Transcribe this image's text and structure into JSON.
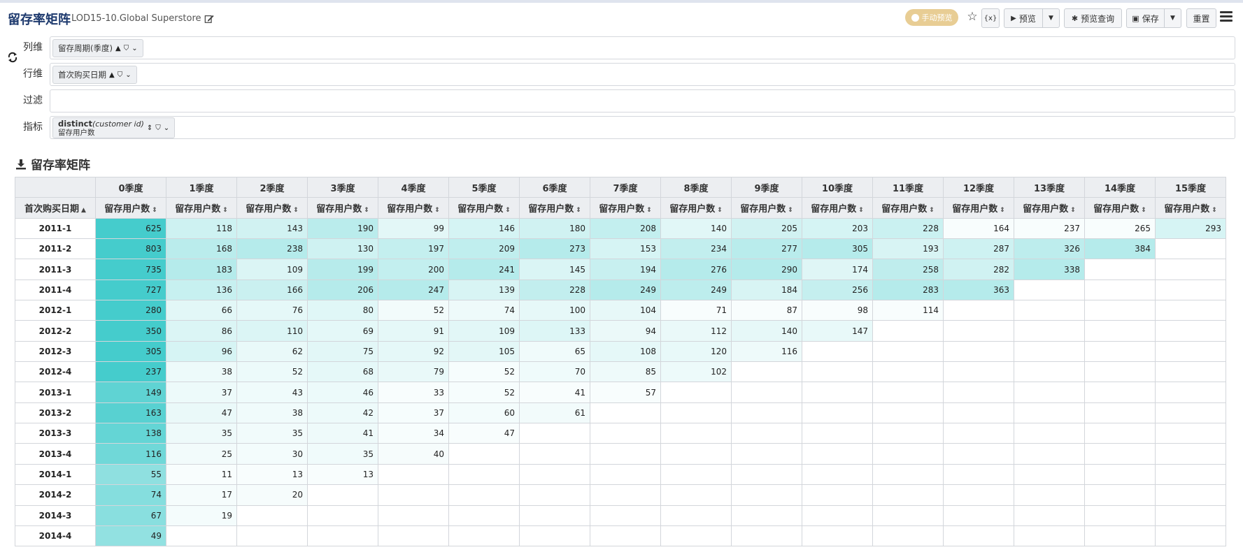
{
  "header": {
    "title": "留存率矩阵",
    "subtitle": "LOD15-10.Global Superstore",
    "manual_preview": "手动预览",
    "var_label": "{x}",
    "preview": "预览",
    "preview_query": "预览查询",
    "save": "保存",
    "reset": "重置"
  },
  "shelves": {
    "columns": {
      "label": "列维",
      "chip": "留存周期(季度)"
    },
    "rows": {
      "label": "行维",
      "chip": "首次购买日期"
    },
    "filter": {
      "label": "过滤"
    },
    "metrics": {
      "label": "指标",
      "chip_func": "distinct",
      "chip_arg": "(customer id)",
      "chip_alias": "留存用户数"
    }
  },
  "section_title": "留存率矩阵",
  "table": {
    "row_header_label": "首次购买日期",
    "column_quarters": [
      "0季度",
      "1季度",
      "2季度",
      "3季度",
      "4季度",
      "5季度",
      "6季度",
      "7季度",
      "8季度",
      "9季度",
      "10季度",
      "11季度",
      "12季度",
      "13季度",
      "14季度",
      "15季度"
    ],
    "metric_label": "留存用户数",
    "rows": [
      {
        "date": "2011-1",
        "values": [
          625,
          118,
          143,
          190,
          99,
          146,
          180,
          208,
          140,
          205,
          203,
          228,
          164,
          237,
          265,
          293
        ]
      },
      {
        "date": "2011-2",
        "values": [
          803,
          168,
          238,
          130,
          197,
          209,
          273,
          153,
          234,
          277,
          305,
          193,
          287,
          326,
          384
        ]
      },
      {
        "date": "2011-3",
        "values": [
          735,
          183,
          109,
          199,
          200,
          241,
          145,
          194,
          276,
          290,
          174,
          258,
          282,
          338
        ]
      },
      {
        "date": "2011-4",
        "values": [
          727,
          136,
          166,
          206,
          247,
          139,
          228,
          249,
          249,
          184,
          256,
          283,
          363
        ]
      },
      {
        "date": "2012-1",
        "values": [
          280,
          66,
          76,
          80,
          52,
          74,
          100,
          104,
          71,
          87,
          98,
          114
        ]
      },
      {
        "date": "2012-2",
        "values": [
          350,
          86,
          110,
          69,
          91,
          109,
          133,
          94,
          112,
          140,
          147
        ]
      },
      {
        "date": "2012-3",
        "values": [
          305,
          96,
          62,
          75,
          92,
          105,
          65,
          108,
          120,
          116
        ]
      },
      {
        "date": "2012-4",
        "values": [
          237,
          38,
          52,
          68,
          79,
          52,
          70,
          85,
          102
        ]
      },
      {
        "date": "2013-1",
        "values": [
          149,
          37,
          43,
          46,
          33,
          52,
          41,
          57
        ]
      },
      {
        "date": "2013-2",
        "values": [
          163,
          47,
          38,
          42,
          37,
          60,
          61
        ]
      },
      {
        "date": "2013-3",
        "values": [
          138,
          35,
          35,
          41,
          34,
          47
        ]
      },
      {
        "date": "2013-4",
        "values": [
          116,
          25,
          30,
          35,
          40
        ]
      },
      {
        "date": "2014-1",
        "values": [
          55,
          11,
          13,
          13
        ]
      },
      {
        "date": "2014-2",
        "values": [
          74,
          17,
          20
        ]
      },
      {
        "date": "2014-3",
        "values": [
          67,
          19
        ]
      },
      {
        "date": "2014-4",
        "values": [
          49
        ]
      }
    ]
  },
  "colors": {
    "accent": "#1e3a6e",
    "heat_max": "#45cccc",
    "pill": "#e8cd94"
  }
}
